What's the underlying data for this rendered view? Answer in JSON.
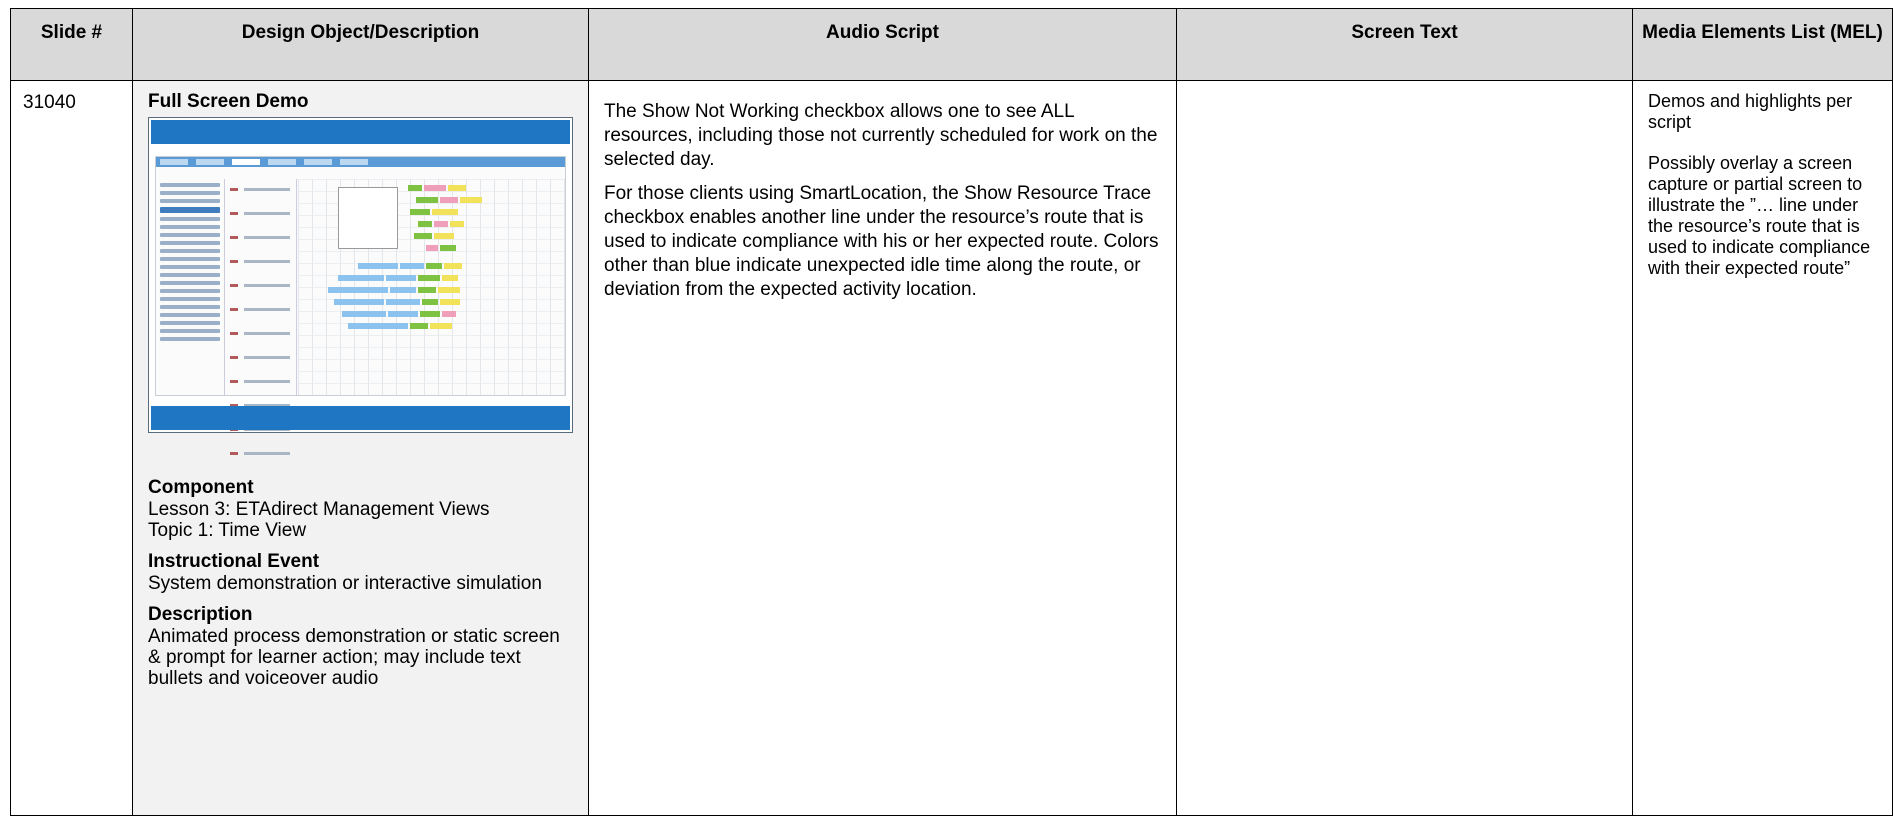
{
  "headers": {
    "slide": "Slide #",
    "design": "Design Object/Description",
    "audio": "Audio Script",
    "screen": "Screen Text",
    "mel": "Media Elements List (MEL)"
  },
  "row": {
    "slide_number": "31040",
    "design": {
      "title": "Full Screen Demo",
      "component_label": "Component",
      "component_line1": "Lesson 3: ETAdirect Management Views",
      "component_line2": "Topic 1: Time View",
      "event_label": "Instructional Event",
      "event_text": "System demonstration or interactive simulation",
      "description_label": "Description",
      "description_text": "Animated process demonstration or static screen & prompt for learner action; may include text bullets and voiceover audio"
    },
    "audio": {
      "paragraph1": "The Show Not Working checkbox allows one to see ALL resources, including those not currently scheduled for work on the selected day.",
      "paragraph2": "For those clients using SmartLocation, the Show Resource Trace checkbox enables another line under the resource’s route that is used to indicate compliance with his or her expected route.  Colors other than blue indicate unexpected idle time along the route, or deviation from the expected activity location."
    },
    "screen_text": "",
    "mel": {
      "paragraph1": "Demos and highlights per script",
      "paragraph2": "Possibly overlay a screen capture or partial screen to illustrate the ”… line under the resource’s route that is used to indicate compliance with their expected route”"
    }
  },
  "colors": {
    "header_bg": "#d9d9d9",
    "design_cell_bg": "#f2f2f2",
    "screenshot_frame": "#1f77c4"
  }
}
